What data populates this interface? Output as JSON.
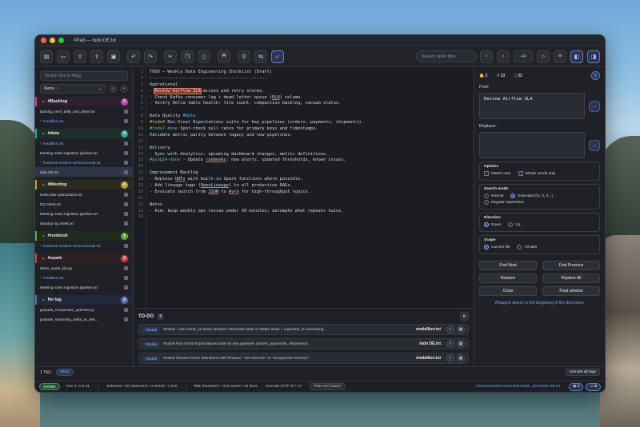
{
  "window": {
    "title": "#Pad — todo DE.txt"
  },
  "toolbar": {
    "search_placeholder": "Search open files",
    "regex_label": "• R",
    "icons": [
      "new-file-icon",
      "open-folder-icon",
      "export-icon",
      "share-icon",
      "print-icon",
      "undo-icon",
      "redo-icon",
      "cut-icon",
      "copy-icon",
      "paste-icon",
      "bookmark-icon",
      "search-icon",
      "replace-icon",
      "spellcheck-icon"
    ]
  },
  "sidebar": {
    "search_placeholder": "Search files or #tags",
    "sort_label": "Name ↑",
    "groups": [
      {
        "tag": "#Backlog",
        "count": "2",
        "color": "#b94aa3",
        "bg": "#2d2030",
        "files": [
          {
            "name": "backlog_tech_debt_and_ideas.txt",
            "link": false,
            "sel": false
          },
          {
            "name": "medallion.txt",
            "link": true,
            "sel": false
          }
        ]
      },
      {
        "tag": "#data",
        "count": "4",
        "color": "#3aa39a",
        "bg": "#1f2d2c",
        "files": [
          {
            "name": "medallion.txt",
            "link": true,
            "sel": false
          },
          {
            "name": "Meeting notes ingestion pipeline.txt",
            "link": false,
            "sel": false
          },
          {
            "name": "Runbook incident schema break.txt",
            "link": true,
            "sel": false
          },
          {
            "name": "todo DE.txt",
            "link": false,
            "sel": true
          }
        ]
      },
      {
        "tag": "#Meeting",
        "count": "4",
        "color": "#b9a23a",
        "bg": "#2d2a1e",
        "files": [
          {
            "name": "Delta lake optimization.txt",
            "link": false,
            "sel": false
          },
          {
            "name": "DQ Alerts.txt",
            "link": false,
            "sel": false
          },
          {
            "name": "Meeting notes ingestion pipeline.txt",
            "link": false,
            "sel": false
          },
          {
            "name": "standup log week.txt",
            "link": false,
            "sel": false
          }
        ]
      },
      {
        "tag": "#runbook",
        "count": "1",
        "color": "#5fa83a",
        "bg": "#222c1e",
        "files": [
          {
            "name": "Runbook incident schema break.txt",
            "link": true,
            "sel": false
          }
        ]
      },
      {
        "tag": "#spark",
        "count": "3",
        "color": "#c24848",
        "bg": "#2e1f22",
        "files": [
          {
            "name": "demo_spark_job.py",
            "link": false,
            "sel": false
          },
          {
            "name": "medallion.txt",
            "link": true,
            "sel": false
          },
          {
            "name": "Meeting notes ingestion pipeline.txt",
            "link": false,
            "sel": false
          }
        ]
      },
      {
        "tag": "No tag",
        "count": "2",
        "color": "#5b6fa8",
        "bg": "#23273a",
        "files": [
          {
            "name": "pyspark_compaction_optimize.py",
            "link": false,
            "sel": false
          },
          {
            "name": "pyspark_streaming_kafka_to_delt...",
            "link": false,
            "sel": false
          }
        ]
      }
    ]
  },
  "editor": {
    "line_numbers": [
      "1",
      "2",
      "3",
      "4",
      "5",
      "6",
      "7",
      "8",
      "9",
      "10",
      "11",
      "12",
      "13",
      "14",
      "15",
      "16",
      "17",
      "18",
      "19",
      "20",
      "21",
      "22",
      "23",
      "24"
    ],
    "lines": [
      "TODO — Weekly Data Engineering Checklist (Draft)",
      "----------------------------------------------",
      "Operational",
      "- Review Airflow SLA misses and retry storms.",
      "- Check Kafka consumer lag + dead letter queue (DLQ) volume.",
      "- Verify Delta table health: file count, compaction backlog, vacuum status.",
      "",
      "Data Quality #data",
      "#todo6 Run Great Expectations suite for key pipelines (orders, payments, shipments).",
      "#todo7-done Spot-check null rates for primary keys and timestamps.",
      "Validate metric parity between legacy and new pipelines.",
      "",
      "Delivery",
      "- Sync with Analytics: upcoming dashboard changes, metric definitions.",
      "#ping14-done - Update runbooks: new alerts, updated thresholds, known issues.",
      "",
      "Improvement Backlog",
      "- Replace UDFs with built-in Spark functions where possible.",
      "- Add lineage tags (OpenLineage) to all production DAGs.",
      "- Evaluate switch from JSON to Avro for high-throughput topics.",
      "",
      "Notes",
      "- Aim: keep weekly ops review under 30 minutes; automate what repeats twice.",
      ""
    ]
  },
  "todo": {
    "title": "TO-DO",
    "count": "5",
    "items": [
      {
        "tag": "#todo9",
        "text": "#todo9 - Use event_id where present; otherwise hash of stable fields + ingestion_ts windowing.",
        "file": "medallion.txt"
      },
      {
        "tag": "#todo6",
        "text": "#todo6 Run Great Expectations suite for key pipelines (orders, payments, shipments).",
        "file": "todo DE.txt"
      },
      {
        "tag": "#todo5",
        "text": "#todo5 Review metric definitions with Finance: \"net revenue\" vs \"recognized revenue\".",
        "file": "medallion.txt"
      }
    ]
  },
  "find": {
    "stats": {
      "bell": "2",
      "hash": "13",
      "doc": "32"
    },
    "find_label": "Find:",
    "find_value": "Review Airflow SLA",
    "replace_label": "Replace:",
    "replace_value": "",
    "options": {
      "title": "Options",
      "match_case": "Match case",
      "whole_words": "Whole words only"
    },
    "search_mode": {
      "title": "Search mode",
      "normal": "Normal",
      "extended": "Extended (\\n, \\r, \\t...)",
      "regex": "Regular expression"
    },
    "direction": {
      "title": "Direction",
      "down": "Down",
      "up": "Up"
    },
    "scope": {
      "title": "Scope",
      "current": "Current file",
      "all": "All tabs"
    },
    "buttons": {
      "find_next": "Find Next",
      "find_prev": "Find Previous",
      "replace": "Replace",
      "replace_all": "Replace All",
      "close": "Close",
      "float": "Float window"
    },
    "message": "Wrapped search to the beginning of the document."
  },
  "tagbar": {
    "count_label": "1 TAG",
    "chip": "#data",
    "unmark": "Unmark all tags"
  },
  "statusbar": {
    "saved": "SAVED",
    "position": "Line 4, Col 21",
    "selection": "Selection: 18 characters • 3 words • 1 line",
    "counts": "968 characters • 134 words • 24 lines",
    "encoding": "Unicode (UTF-8) • LF",
    "mode": "Plain text (auto)",
    "path": "/Users/aren/Documents/sample_docs/todo DE.txt",
    "pill1": "2",
    "pill2": "8"
  },
  "colors": {
    "accent": "#5b7bd6",
    "highlight": "#e0765c",
    "tag_yellow": "#e6b94f",
    "tag_green": "#66c28a",
    "link": "#7da9ff"
  }
}
